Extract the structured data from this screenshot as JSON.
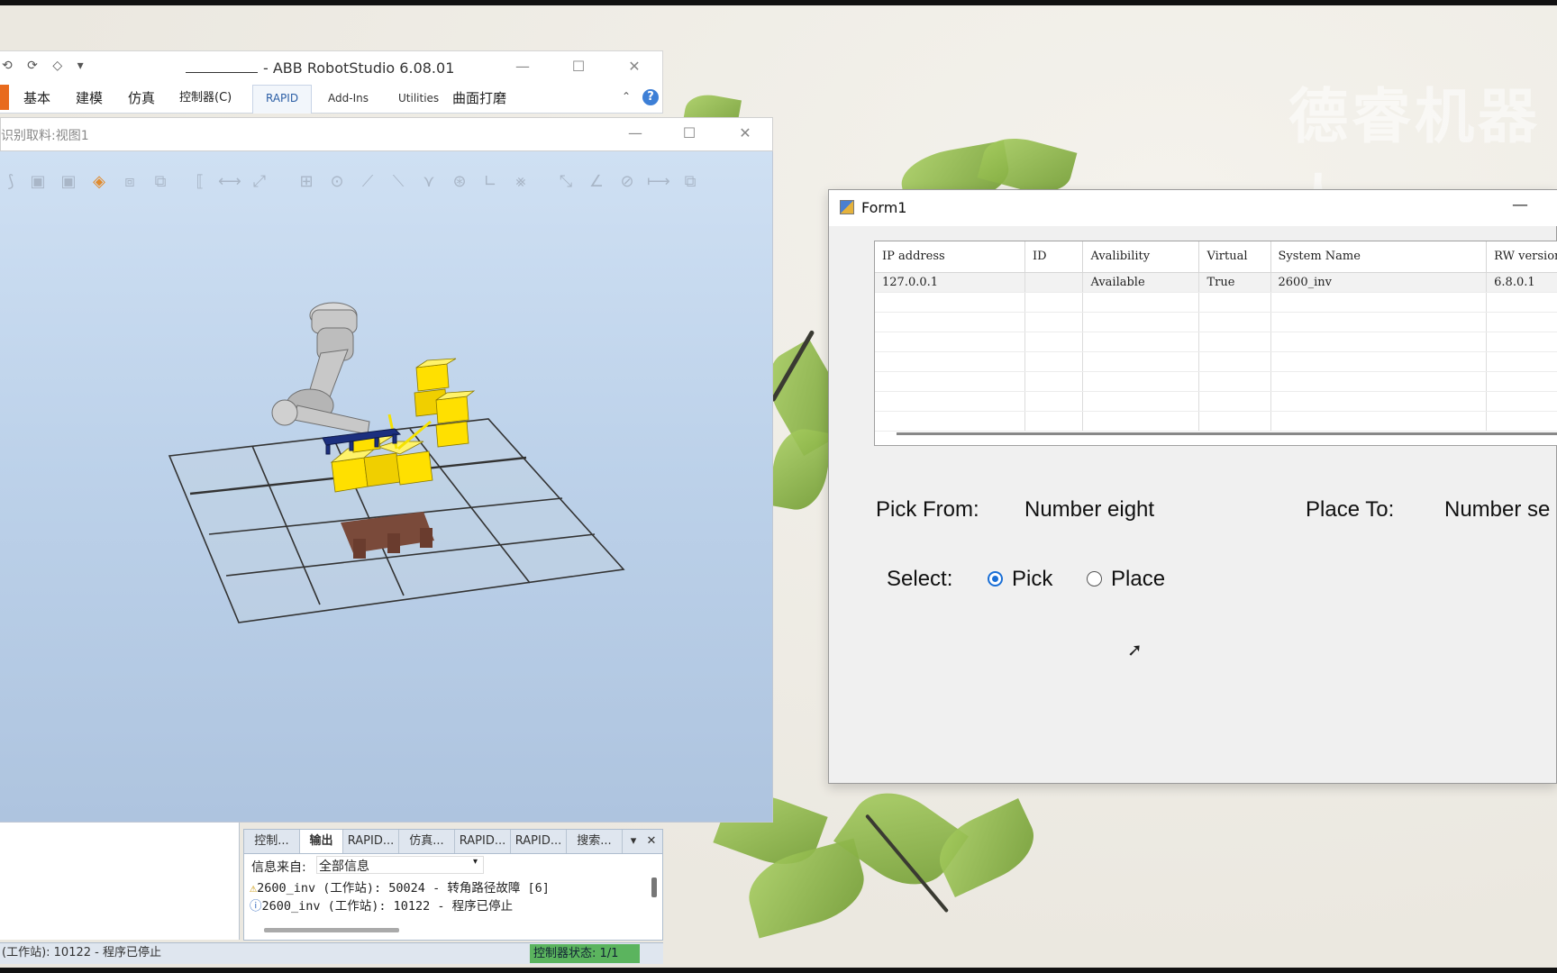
{
  "wallpaper": {
    "watermark": "德睿机器人"
  },
  "robotstudio": {
    "window_title": "- ABB RobotStudio 6.08.01",
    "ribbon_tabs": [
      "基本",
      "建模",
      "仿真",
      "控制器(C)",
      "RAPID",
      "Add-Ins",
      "Utilities",
      "曲面打磨"
    ],
    "active_tab": "RAPID",
    "help_label": "?"
  },
  "viewport": {
    "title": "识别取料:视图1"
  },
  "output": {
    "tabs": [
      "控制...",
      "输出",
      "RAPID...",
      "仿真...",
      "RAPID...",
      "RAPID...",
      "搜索..."
    ],
    "active_tab": "输出",
    "source_label": "信息来自:",
    "source_value": "全部信息",
    "messages": [
      {
        "icon": "warning-icon",
        "text": "2600_inv (工作站): 50024 - 转角路径故障 [6]"
      },
      {
        "icon": "info-icon",
        "text": "2600_inv (工作站): 10122 - 程序已停止"
      }
    ]
  },
  "status_bar": {
    "message": "(工作站): 10122 - 程序已停止",
    "controller_status": "控制器状态:  1/1"
  },
  "form1": {
    "title": "Form1",
    "grid": {
      "columns": [
        "IP address",
        "ID",
        "Avalibility",
        "Virtual",
        "System Name",
        "RW version"
      ],
      "rows": [
        [
          "127.0.0.1",
          "",
          "Available",
          "True",
          "2600_inv",
          "6.8.0.1"
        ]
      ]
    },
    "pick_from_label": "Pick From:",
    "pick_from_value": "Number eight",
    "place_to_label": "Place To:",
    "place_to_value": "Number se",
    "select_label": "Select:",
    "option_pick": "Pick",
    "option_place": "Place",
    "selected_option": "Pick"
  },
  "colors": {
    "accent": "#1a6fd6",
    "controller_ok": "#5bb45e",
    "file_tab": "#e86a1d"
  }
}
